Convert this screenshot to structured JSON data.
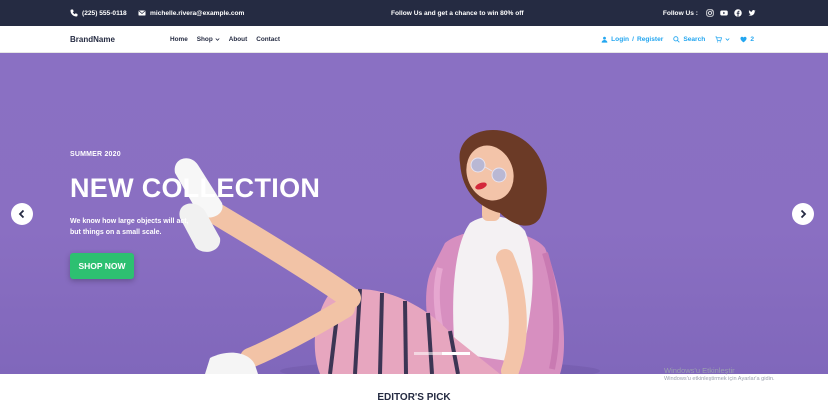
{
  "topbar": {
    "phone": "(225) 555-0118",
    "email": "michelle.rivera@example.com",
    "promo": "Follow Us and get a chance to win 80% off",
    "follow_label": "Follow Us :",
    "social_icons": [
      "instagram-icon",
      "youtube-icon",
      "facebook-icon",
      "twitter-icon"
    ]
  },
  "nav": {
    "brand": "BrandName",
    "menu": [
      "Home",
      "Shop",
      "About",
      "Contact"
    ],
    "login": "Login",
    "separator": "/",
    "register": "Register",
    "search": "Search",
    "wishlist_count": "2"
  },
  "hero": {
    "subtitle": "SUMMER 2020",
    "title": "NEW COLLECTION",
    "description_line1": "We know how large objects will act,",
    "description_line2": "but things on a small scale.",
    "cta": "SHOP NOW",
    "slides": 2,
    "active_slide": 1
  },
  "watermark": {
    "line1": "Windows'u Etkinleştir",
    "line2": "Windows'u etkinleştirmek için Ayarlar'a gidin."
  },
  "section": {
    "title": "EDITOR'S PICK"
  },
  "colors": {
    "dark": "#252b42",
    "accent": "#23a6f0",
    "success": "#2dc071",
    "hero_bg": "#8a70c3"
  }
}
